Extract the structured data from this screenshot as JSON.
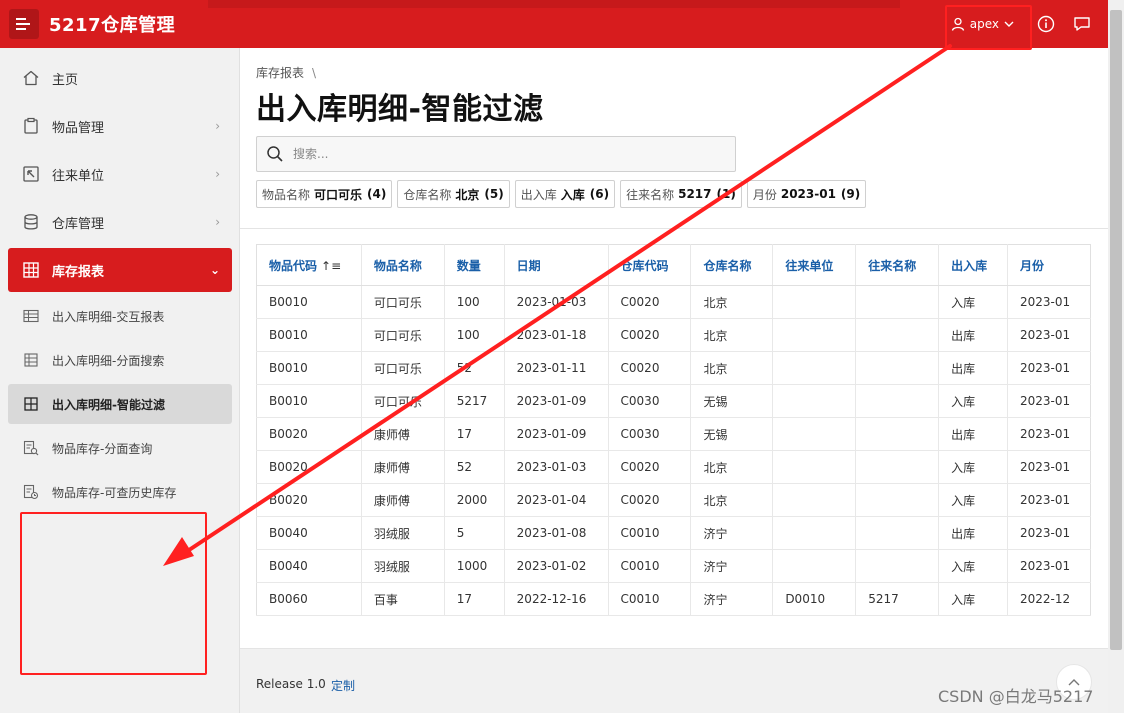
{
  "app": {
    "title": "5217仓库管理",
    "user": "apex"
  },
  "sidebar": {
    "items": [
      {
        "label": "主页",
        "icon": "home-icon"
      },
      {
        "label": "物品管理",
        "icon": "clipboard-icon"
      },
      {
        "label": "往来单位",
        "icon": "arrow-box-icon"
      },
      {
        "label": "仓库管理",
        "icon": "database-icon"
      },
      {
        "label": "库存报表",
        "icon": "table-icon"
      }
    ],
    "subitems": [
      {
        "label": "出入库明细-交互报表",
        "icon": "table-icon"
      },
      {
        "label": "出入库明细-分面搜索",
        "icon": "table-icon"
      },
      {
        "label": "出入库明细-智能过滤",
        "icon": "table-icon"
      },
      {
        "label": "物品库存-分面查询",
        "icon": "report-search-icon"
      },
      {
        "label": "物品库存-可查历史库存",
        "icon": "report-history-icon"
      }
    ]
  },
  "breadcrumb": {
    "parent": "库存报表",
    "separator": "\\"
  },
  "page": {
    "title": "出入库明细-智能过滤"
  },
  "search": {
    "placeholder": "搜索..."
  },
  "filters": [
    {
      "label": "物品名称",
      "value": "可口可乐",
      "count": "(4)"
    },
    {
      "label": "仓库名称",
      "value": "北京",
      "count": "(5)"
    },
    {
      "label": "出入库",
      "value": "入库",
      "count": "(6)"
    },
    {
      "label": "往来名称",
      "value": "5217",
      "count": "(1)"
    },
    {
      "label": "月份",
      "value": "2023-01",
      "count": "(9)"
    }
  ],
  "table": {
    "columns": [
      "物品代码",
      "物品名称",
      "数量",
      "日期",
      "仓库代码",
      "仓库名称",
      "往来单位",
      "往来名称",
      "出入库",
      "月份"
    ],
    "rows": [
      [
        "B0010",
        "可口可乐",
        "100",
        "2023-01-03",
        "C0020",
        "北京",
        "",
        "",
        "入库",
        "2023-01"
      ],
      [
        "B0010",
        "可口可乐",
        "100",
        "2023-01-18",
        "C0020",
        "北京",
        "",
        "",
        "出库",
        "2023-01"
      ],
      [
        "B0010",
        "可口可乐",
        "52",
        "2023-01-11",
        "C0020",
        "北京",
        "",
        "",
        "出库",
        "2023-01"
      ],
      [
        "B0010",
        "可口可乐",
        "5217",
        "2023-01-09",
        "C0030",
        "无锡",
        "",
        "",
        "入库",
        "2023-01"
      ],
      [
        "B0020",
        "康师傅",
        "17",
        "2023-01-09",
        "C0030",
        "无锡",
        "",
        "",
        "出库",
        "2023-01"
      ],
      [
        "B0020",
        "康师傅",
        "52",
        "2023-01-03",
        "C0020",
        "北京",
        "",
        "",
        "入库",
        "2023-01"
      ],
      [
        "B0020",
        "康师傅",
        "2000",
        "2023-01-04",
        "C0020",
        "北京",
        "",
        "",
        "入库",
        "2023-01"
      ],
      [
        "B0040",
        "羽绒服",
        "5",
        "2023-01-08",
        "C0010",
        "济宁",
        "",
        "",
        "出库",
        "2023-01"
      ],
      [
        "B0040",
        "羽绒服",
        "1000",
        "2023-01-02",
        "C0010",
        "济宁",
        "",
        "",
        "入库",
        "2023-01"
      ],
      [
        "B0060",
        "百事",
        "17",
        "2022-12-16",
        "C0010",
        "济宁",
        "D0010",
        "5217",
        "入库",
        "2022-12"
      ]
    ]
  },
  "footer": {
    "release": "Release 1.0",
    "customize": "定制"
  },
  "watermark": "CSDN @白龙马5217",
  "colors": {
    "brand": "#d71c1e",
    "link": "#1a5fa8",
    "annotation": "#ff2020"
  }
}
